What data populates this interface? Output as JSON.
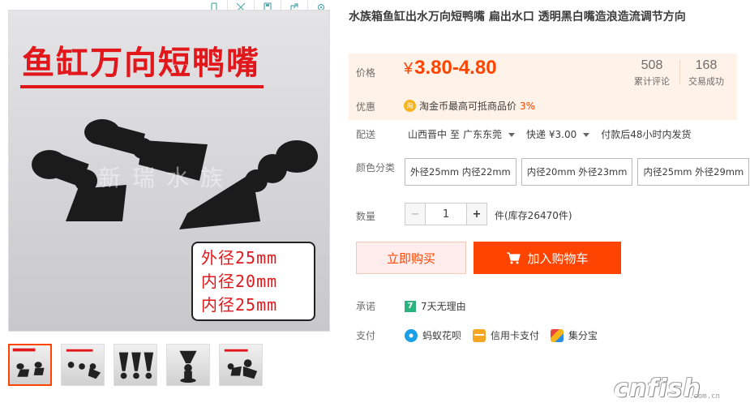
{
  "toolbar": {
    "icons": [
      "phone-icon",
      "expand-icon",
      "save-icon",
      "share-icon",
      "settings-icon"
    ]
  },
  "gallery": {
    "banner": "鱼缸万向短鸭嘴",
    "specs": [
      "外径25mm",
      "内径20mm",
      "内径25mm"
    ],
    "watermark": "新瑞水族",
    "thumb_count": 5,
    "active_thumb": 0
  },
  "product": {
    "title": "水族箱鱼缸出水万向短鸭嘴 扁出水口 透明黑白嘴造浪造流调节方向"
  },
  "price": {
    "label": "价格",
    "currency": "¥",
    "value": "3.80-4.80",
    "reviews_count": "508",
    "reviews_label": "累计评论",
    "sales_count": "168",
    "sales_label": "交易成功"
  },
  "promo": {
    "label": "优惠",
    "coin_icon": "淘",
    "text": "淘金币最高可抵商品价",
    "percent": "3%"
  },
  "shipping": {
    "label": "配送",
    "from": "山西晋中",
    "to_word": "至",
    "to": "广东东莞",
    "method": "快递 ¥3.00",
    "promise": "付款后48小时内发货"
  },
  "colors": {
    "label": "颜色分类",
    "options": [
      "外径25mm 内径22mm",
      "内径20mm 外径23mm",
      "内径25mm 外径29mm"
    ]
  },
  "quantity": {
    "label": "数量",
    "minus": "−",
    "value": "1",
    "plus": "+",
    "stock": "件(库存26470件)"
  },
  "actions": {
    "buy_now": "立即购买",
    "add_to_cart": "加入购物车"
  },
  "guarantee": {
    "label": "承诺",
    "badge": "7",
    "text": "7天无理由"
  },
  "payment": {
    "label": "支付",
    "methods": [
      "蚂蚁花呗",
      "信用卡支付",
      "集分宝"
    ]
  },
  "watermark_logo": {
    "text": "cnfish",
    "sub": ".com.cn"
  },
  "colors_theme": {
    "accent": "#ff4400",
    "price_bg": "#fff2e8"
  }
}
